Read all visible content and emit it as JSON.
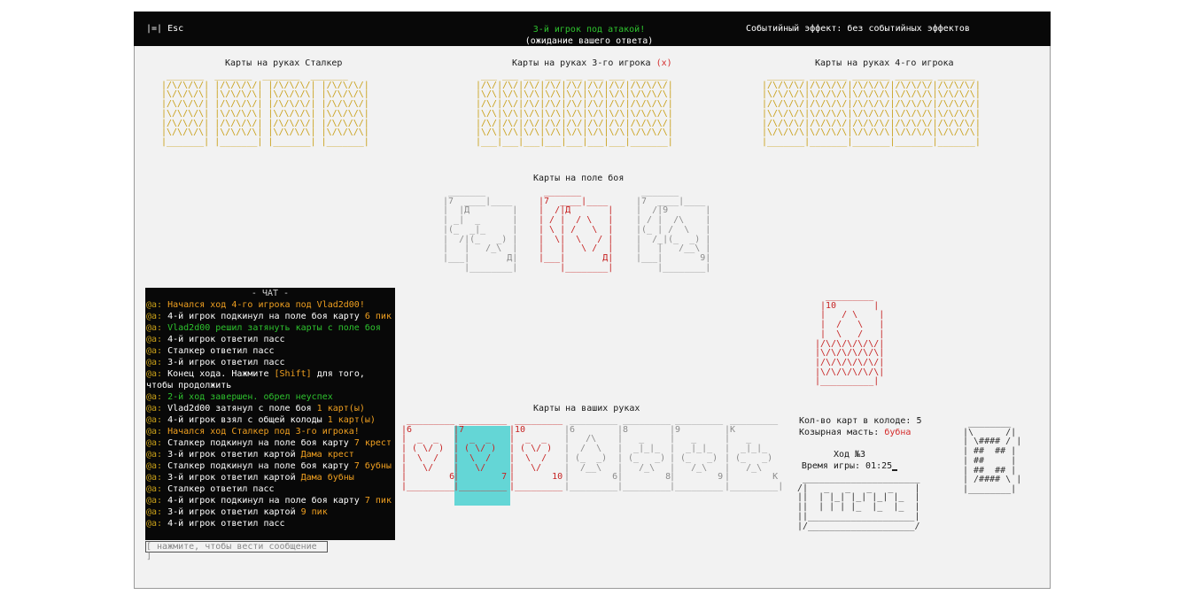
{
  "topbar": {
    "esc_icon": "|=|",
    "esc_label": "Esc",
    "status_line1": "3-й игрок под атакой!",
    "status_line2": "(ожидание вашего ответа)",
    "event_effect": "Событийный эффект: без событийных эффектов"
  },
  "hands": {
    "stalker": "Карты на руках Сталкер",
    "player3": "Карты на руках 3-го игрока",
    "player3_mark": "(x)",
    "player4": "Карты на руках 4-го игрока",
    "battlefield": "Карты на поле боя",
    "yours": "Карты на ваших руках"
  },
  "art": {
    "stalker_backs": " _______  _______  _______  _______\n|/\\/\\/\\/| |/\\/\\/\\/| |/\\/\\/\\/| |/\\/\\/\\/|\n|\\/\\/\\/\\| |\\/\\/\\/\\| |\\/\\/\\/\\| |\\/\\/\\/\\|\n|/\\/\\/\\/| |/\\/\\/\\/| |/\\/\\/\\/| |/\\/\\/\\/|\n|\\/\\/\\/\\| |\\/\\/\\/\\| |\\/\\/\\/\\| |\\/\\/\\/\\|\n|/\\/\\/\\/| |/\\/\\/\\/| |/\\/\\/\\/| |/\\/\\/\\/|\n|\\/\\/\\/\\| |\\/\\/\\/\\| |\\/\\/\\/\\| |\\/\\/\\/\\|\n|_______| |_______| |_______| |_______|",
    "p3_backs": " ___ ___ ___ ___ ___ ___ ___ _______\n|/\\/|/\\/|/\\/|/\\/|/\\/|/\\/|/\\/|/\\/\\/\\/|\n|\\/\\|\\/\\|\\/\\|\\/\\|\\/\\|\\/\\|\\/\\|\\/\\/\\/\\|\n|/\\/|/\\/|/\\/|/\\/|/\\/|/\\/|/\\/|/\\/\\/\\/|\n|\\/\\|\\/\\|\\/\\|\\/\\|\\/\\|\\/\\|\\/\\|\\/\\/\\/\\|\n|/\\/|/\\/|/\\/|/\\/|/\\/|/\\/|/\\/|/\\/\\/\\/|\n|\\/\\|\\/\\|\\/\\|\\/\\|\\/\\|\\/\\|\\/\\|\\/\\/\\/\\|\n|___|___|___|___|___|___|___|_______|",
    "p4_backs": " _______ _______ _______ _______ _______\n|/\\/\\/\\/|/\\/\\/\\/|/\\/\\/\\/|/\\/\\/\\/|/\\/\\/\\/|\n|\\/\\/\\/\\|\\/\\/\\/\\|\\/\\/\\/\\|\\/\\/\\/\\|\\/\\/\\/\\|\n|/\\/\\/\\/|/\\/\\/\\/|/\\/\\/\\/|/\\/\\/\\/|/\\/\\/\\/|\n|\\/\\/\\/\\|\\/\\/\\/\\|\\/\\/\\/\\|\\/\\/\\/\\|\\/\\/\\/\\|\n|/\\/\\/\\/|/\\/\\/\\/|/\\/\\/\\/|/\\/\\/\\/|/\\/\\/\\/|\n|\\/\\/\\/\\|\\/\\/\\/\\|\\/\\/\\/\\|\\/\\/\\/\\|\\/\\/\\/\\|\n|_______|_______|_______|_______|_______|",
    "bf1": "  _______\n |7  ____|____\n |  |Д        |\n | _|  _      |\n |(_  _|_     |\n |  /|(_   _) |\n |   |   /_\\  |\n |___|       Д|\n     |________|",
    "bf2": "  _______\n |7  ____|____\n |  /|Д       |\n | / |  / \\   |\n | \\ | /   \\  |\n |  \\|  \\   / |\n |   |   \\ /  |\n |___|       Д|\n     |________|",
    "bf3": "  _______\n |7  ____|____\n |  /|9       |\n | / |  /\\    |\n |(_ | /  \\   |\n |  /_|(_  _) |\n |   |   /__\\ |\n |___|       9|\n     |________|",
    "trump": "  _________\n |10       |\n |   / \\    |\n |  /   \\   |\n |  \\   /   |\n|/\\/\\/\\/\\/\\/|\n|\\/\\/\\/\\/\\/\\|\n|/\\/\\/\\/\\/\\/|\n|\\/\\/\\/\\/\\/\\|\n|__________|",
    "hand_6h": " _________\n|6        \n|  _  _   \n| ( \\/ )  \n|  \\  /   \n|   \\/    \n|        6\n|_________",
    "hand_7h": " _________\n|7        \n|  _  _   \n| ( \\/ )  \n|  \\  /   \n|   \\/    \n|        7\n|_________",
    "hand_10h": " _________\n|10       \n|  _  _   \n| ( \\/ )  \n|  \\  /   \n|   \\/    \n|       10\n|_________",
    "hand_6s": " _________\n|6        \n|   /\\    \n|  /  \\   \n| (_  _)  \n|  /__\\   \n|        6\n|_________",
    "hand_8c": " _________\n|8        \n|   _     \n|  _|_|_  \n| (_   _) \n|   /_\\   \n|        8\n|_________",
    "hand_9c": " _________\n|9        \n|   _     \n|  _|_|_  \n| (_   _) \n|   /_\\   \n|        9\n|_________",
    "hand_ks": " _________\n|K        \n|   _     \n|  _|_|_  \n| (_   _) \n|   /_\\   \n|        K\n|_________|",
    "pass_btn": " ______________________\n/|   _   _   _   _    |\n||  | |_| |_| |_| |_  |\n||  | | | |_  |_  |_  |\n||____________________|\n|/____________________/",
    "deck_card": " ________\n|\\      /|\n| \\#### / |\n| ##  ## |\n| ##     |\n| ##  ## |\n| /#### \\ |\n|________|"
  },
  "chat": {
    "title": "- ЧАТ -",
    "prefix": "@a:",
    "lines": [
      {
        "t": "Начался ход 4-го игрока под Vlad2d00!",
        "c": "c-ora"
      },
      {
        "t": "4-й игрок подкинул на поле боя карту ",
        "hl": "6 пик",
        "c": "c-wht"
      },
      {
        "t": "Vlad2d00 решил затянуть карты с поле боя",
        "c": "c-grn"
      },
      {
        "t": "4-й игрок ответил пасс",
        "c": "c-wht"
      },
      {
        "t": "Сталкер ответил пасс",
        "c": "c-wht"
      },
      {
        "t": "3-й игрок ответил пасс",
        "c": "c-wht"
      },
      {
        "t": "Конец хода. Нажмите ",
        "hl": "[Shift]",
        "tail": " для того, чтобы продолжить",
        "c": "c-wht"
      },
      {
        "t": "2-й ход завершен. обрел неуспех",
        "c": "c-grn"
      },
      {
        "t": "Vlad2d00 затянул с поле боя ",
        "hl": "1 карт(ы)",
        "c": "c-wht"
      },
      {
        "t": "4-й игрок взял с общей колоды ",
        "hl": "1 карт(ы)",
        "c": "c-wht"
      },
      {
        "t": "Начался ход Сталкер под 3-го игрока!",
        "c": "c-ora"
      },
      {
        "t": "Сталкер подкинул на поле боя карту ",
        "hl": "7 крест",
        "c": "c-wht"
      },
      {
        "t": "3-й игрок ответил картой ",
        "hl": "Дама крест",
        "c": "c-wht"
      },
      {
        "t": "Сталкер подкинул на поле боя карту ",
        "hl": "7 бубны",
        "c": "c-wht"
      },
      {
        "t": "3-й игрок ответил картой ",
        "hl": "Дама бубны",
        "c": "c-wht"
      },
      {
        "t": "Сталкер ответил пасс",
        "c": "c-wht"
      },
      {
        "t": "4-й игрок подкинул на поле боя карту ",
        "hl": "7 пик",
        "c": "c-wht"
      },
      {
        "t": "3-й игрок ответил картой ",
        "hl": "9 пик",
        "c": "c-wht"
      },
      {
        "t": "4-й игрок ответил пасс",
        "c": "c-wht"
      }
    ],
    "input_placeholder": "[ нажмите, чтобы вести сообщение ]"
  },
  "info": {
    "deck_count": "Кол-во карт в колоде: 5",
    "trump_label": "Козырная масть: ",
    "trump_value": "бубна",
    "turn": "Ход №3",
    "time": "Время игры: 01:25"
  },
  "colors": {
    "gold": "#c9a019",
    "red": "#c62222",
    "highlight": "#64d6d6",
    "green": "#2ec32e"
  }
}
